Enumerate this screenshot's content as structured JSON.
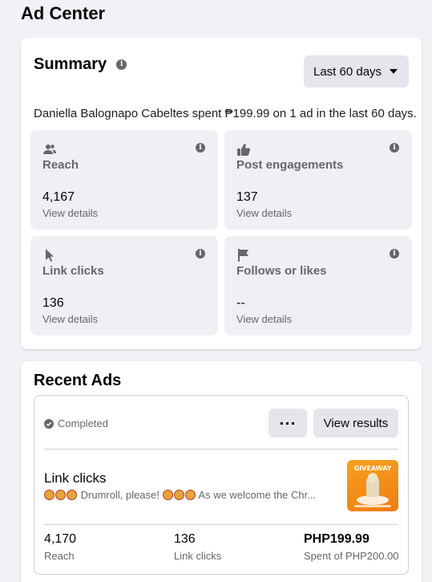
{
  "page": {
    "title": "Ad Center"
  },
  "summary": {
    "title": "Summary",
    "date_range": "Last 60 days",
    "spent_text": "Daniella Balognapo Cabeltes spent ₱199.99 on 1 ad in the last 60 days.",
    "tiles": [
      {
        "icon": "people-icon",
        "label": "Reach",
        "value": "4,167",
        "link": "View details"
      },
      {
        "icon": "thumbs-up-icon",
        "label": "Post engagements",
        "value": "137",
        "link": "View details"
      },
      {
        "icon": "cursor-icon",
        "label": "Link clicks",
        "value": "136",
        "link": "View details"
      },
      {
        "icon": "flag-icon",
        "label": "Follows or likes",
        "value": "--",
        "link": "View details"
      }
    ]
  },
  "recent_ads": {
    "title": "Recent Ads",
    "ad": {
      "status": "Completed",
      "more_label": "···",
      "view_results_label": "View results",
      "objective": "Link clicks",
      "text_part1": "Drumroll, please!",
      "text_part2": "As we welcome the Chr...",
      "thumbnail_text": "GIVEAWAY",
      "metrics": [
        {
          "value": "4,170",
          "label": "Reach"
        },
        {
          "value": "136",
          "label": "Link clicks"
        },
        {
          "value": "PHP199.99",
          "label": "Spent of PHP200.00"
        }
      ]
    }
  }
}
